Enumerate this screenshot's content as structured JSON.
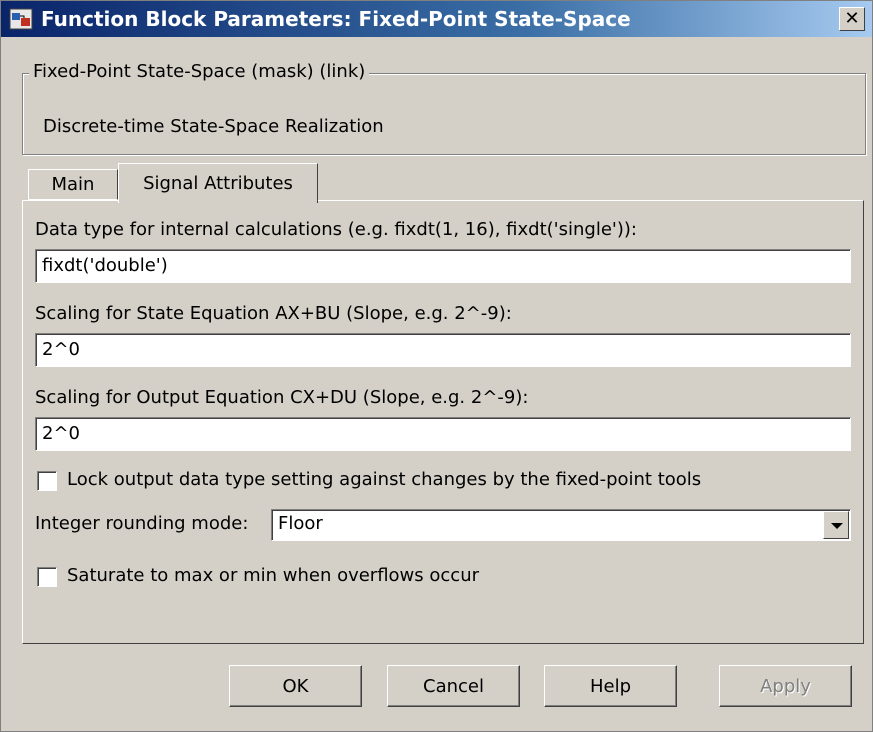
{
  "window": {
    "title": "Function Block Parameters: Fixed-Point State-Space",
    "close_label": "✕"
  },
  "mask": {
    "legend": "Fixed-Point State-Space (mask) (link)",
    "description": "Discrete-time State-Space Realization"
  },
  "tabs": [
    {
      "label": "Main",
      "active": false
    },
    {
      "label": "Signal Attributes",
      "active": true
    }
  ],
  "fields": {
    "data_type_label": "Data type for internal calculations (e.g. fixdt(1, 16), fixdt('single')):",
    "data_type_value": "fixdt('double')",
    "state_scaling_label": "Scaling for State Equation AX+BU (Slope, e.g. 2^-9):",
    "state_scaling_value": "2^0",
    "output_scaling_label": "Scaling for Output Equation CX+DU (Slope, e.g. 2^-9):",
    "output_scaling_value": "2^0"
  },
  "checkboxes": {
    "lock_label": "Lock output data type setting against changes by the fixed-point tools",
    "lock_checked": false,
    "saturate_label": "Saturate to max or min when overflows occur",
    "saturate_checked": false
  },
  "rounding": {
    "label": "Integer rounding mode:",
    "selected": "Floor"
  },
  "buttons": {
    "ok": "OK",
    "cancel": "Cancel",
    "help": "Help",
    "apply": "Apply",
    "apply_enabled": false
  },
  "icons": {
    "app": "simulink-block-icon",
    "close": "close-icon",
    "dropdown": "chevron-down-icon"
  }
}
